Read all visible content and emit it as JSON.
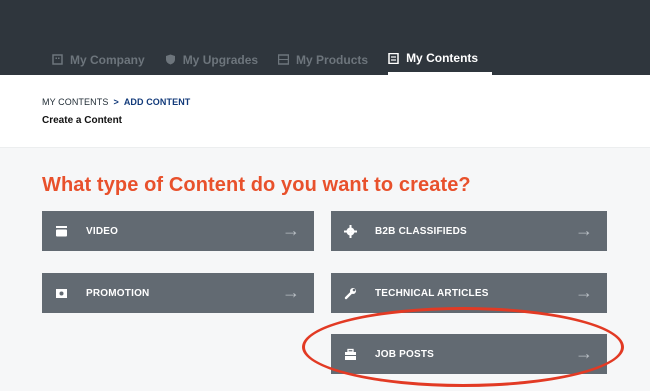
{
  "nav": {
    "tabs": [
      {
        "label": "My Company",
        "icon": "building-icon"
      },
      {
        "label": "My Upgrades",
        "icon": "shield-icon"
      },
      {
        "label": "My Products",
        "icon": "grid-icon"
      },
      {
        "label": "My Contents",
        "icon": "document-icon",
        "active": true
      }
    ]
  },
  "breadcrumb": {
    "root": "MY CONTENTS",
    "separator": ">",
    "current": "ADD CONTENT"
  },
  "page_title": "Create a Content",
  "question": "What type of Content do you want to create?",
  "cards": [
    {
      "label": "VIDEO",
      "icon": "video-camera-icon",
      "arrow": "→"
    },
    {
      "label": "B2B CLASSIFIEDS",
      "icon": "gear-icon",
      "arrow": "→"
    },
    {
      "label": "PROMOTION",
      "icon": "ticket-icon",
      "arrow": "→"
    },
    {
      "label": "TECHNICAL ARTICLES",
      "icon": "wrench-icon",
      "arrow": "→"
    },
    {
      "label": "JOB POSTS",
      "icon": "briefcase-icon",
      "arrow": "→"
    }
  ],
  "colors": {
    "topbar": "#2f363d",
    "accent": "#e8512c",
    "card": "#626a72",
    "highlight_ring": "#e23a24"
  }
}
